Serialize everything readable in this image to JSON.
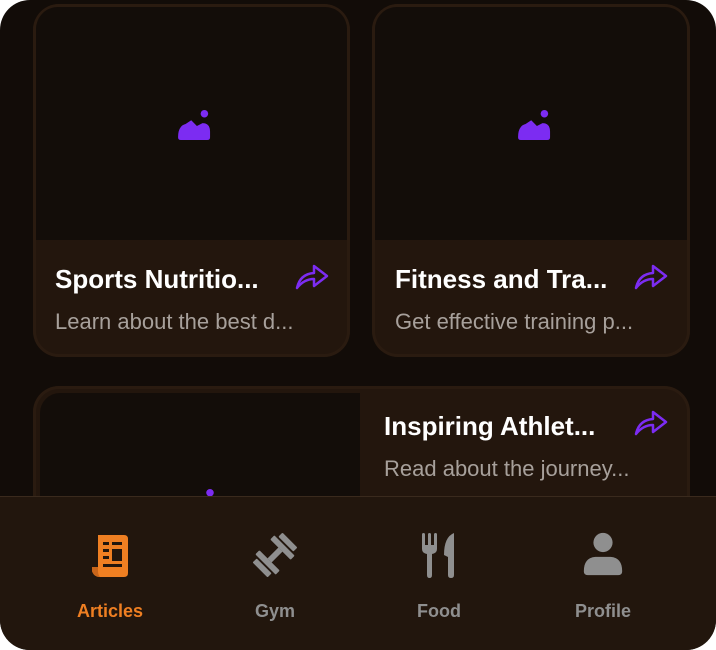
{
  "cards": [
    {
      "title": "Sports Nutritio...",
      "description": "Learn about the best d..."
    },
    {
      "title": "Fitness and Tra...",
      "description": "Get effective training p..."
    },
    {
      "title": "Inspiring Athlet...",
      "description": "Read about the journey..."
    }
  ],
  "icons": {
    "image_placeholder": "image-icon",
    "share": "share-arrow-icon"
  },
  "colors": {
    "background": "#120c08",
    "card": "#23160d",
    "accent": "#ef7f22",
    "placeholder_icon": "#7c2cf2",
    "inactive": "#8f8f8f"
  },
  "nav": {
    "items": [
      {
        "label": "Articles",
        "icon": "article-icon",
        "active": true
      },
      {
        "label": "Gym",
        "icon": "dumbbell-icon",
        "active": false
      },
      {
        "label": "Food",
        "icon": "utensils-icon",
        "active": false
      },
      {
        "label": "Profile",
        "icon": "person-icon",
        "active": false
      }
    ]
  }
}
